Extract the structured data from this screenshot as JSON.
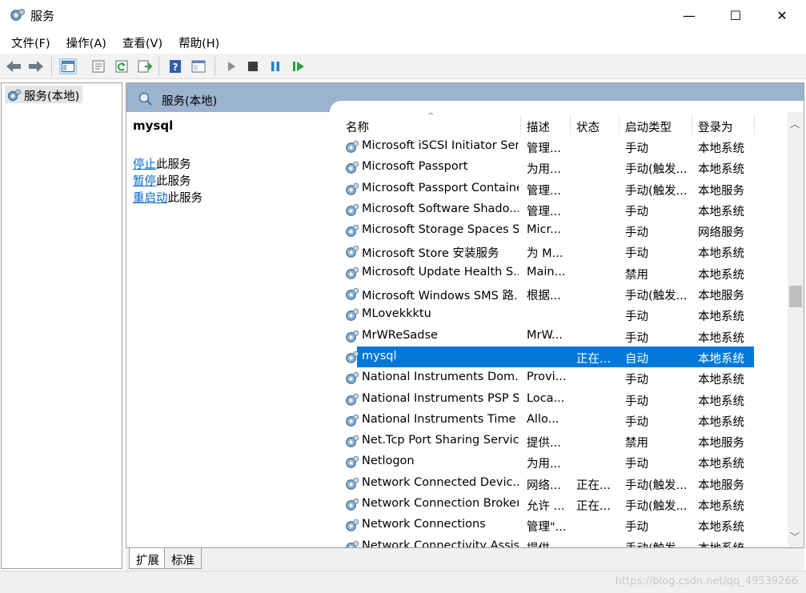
{
  "window": {
    "title": "服务",
    "minimize": "—",
    "maximize": "☐",
    "close": "✕"
  },
  "menu": [
    "文件(F)",
    "操作(A)",
    "查看(V)",
    "帮助(H)"
  ],
  "toolbar": {
    "icons": [
      "back-icon",
      "forward-icon",
      "show-hide-tree-icon",
      "properties-icon",
      "refresh-icon",
      "export-list-icon",
      "help-icon",
      "console-view-icon",
      "start-service-icon",
      "stop-service-icon",
      "pause-service-icon",
      "restart-service-icon"
    ]
  },
  "tree": {
    "root": "服务(本地)"
  },
  "panel": {
    "header": "服务(本地)",
    "selected_service": "mysql",
    "actions": [
      {
        "link": "停止",
        "suffix": "此服务"
      },
      {
        "link": "暂停",
        "suffix": "此服务"
      },
      {
        "link": "重启动",
        "suffix": "此服务"
      }
    ]
  },
  "table": {
    "columns": [
      "名称",
      "描述",
      "状态",
      "启动类型",
      "登录为"
    ],
    "rows": [
      {
        "name": "Microsoft iSCSI Initiator Ser...",
        "desc": "管理...",
        "state": "",
        "start": "手动",
        "logon": "本地系统"
      },
      {
        "name": "Microsoft Passport",
        "desc": "为用...",
        "state": "",
        "start": "手动(触发...",
        "logon": "本地系统"
      },
      {
        "name": "Microsoft Passport Container",
        "desc": "管理...",
        "state": "",
        "start": "手动(触发...",
        "logon": "本地服务"
      },
      {
        "name": "Microsoft Software Shado...",
        "desc": "管理...",
        "state": "",
        "start": "手动",
        "logon": "本地系统"
      },
      {
        "name": "Microsoft Storage Spaces S...",
        "desc": "Micr...",
        "state": "",
        "start": "手动",
        "logon": "网络服务"
      },
      {
        "name": "Microsoft Store 安装服务",
        "desc": "为 M...",
        "state": "",
        "start": "手动",
        "logon": "本地系统"
      },
      {
        "name": "Microsoft Update Health S...",
        "desc": "Main...",
        "state": "",
        "start": "禁用",
        "logon": "本地系统"
      },
      {
        "name": "Microsoft Windows SMS 路...",
        "desc": "根据...",
        "state": "",
        "start": "手动(触发...",
        "logon": "本地服务"
      },
      {
        "name": "MLovekkktu",
        "desc": "",
        "state": "",
        "start": "手动",
        "logon": "本地系统"
      },
      {
        "name": "MrWReSadse",
        "desc": "MrW...",
        "state": "",
        "start": "手动",
        "logon": "本地系统"
      },
      {
        "name": "mysql",
        "desc": "",
        "state": "正在...",
        "start": "自动",
        "logon": "本地系统",
        "selected": true
      },
      {
        "name": "National Instruments Dom...",
        "desc": "Provi...",
        "state": "",
        "start": "手动",
        "logon": "本地系统"
      },
      {
        "name": "National Instruments PSP S...",
        "desc": "Loca...",
        "state": "",
        "start": "手动",
        "logon": "本地系统"
      },
      {
        "name": "National Instruments Time ...",
        "desc": "Allo...",
        "state": "",
        "start": "手动",
        "logon": "本地系统"
      },
      {
        "name": "Net.Tcp Port Sharing Service",
        "desc": "提供...",
        "state": "",
        "start": "禁用",
        "logon": "本地服务"
      },
      {
        "name": "Netlogon",
        "desc": "为用...",
        "state": "",
        "start": "手动",
        "logon": "本地系统"
      },
      {
        "name": "Network Connected Devic...",
        "desc": "网络...",
        "state": "正在...",
        "start": "手动(触发...",
        "logon": "本地服务"
      },
      {
        "name": "Network Connection Broker",
        "desc": "允许 ...",
        "state": "正在...",
        "start": "手动(触发...",
        "logon": "本地系统"
      },
      {
        "name": "Network Connections",
        "desc": "管理\"...",
        "state": "",
        "start": "手动",
        "logon": "本地系统"
      },
      {
        "name": "Network Connectivity Assis...",
        "desc": "提供...",
        "state": "",
        "start": "手动(触发...",
        "logon": "本地系统"
      }
    ]
  },
  "tabs": [
    "扩展",
    "标准"
  ],
  "watermark": "https://blog.csdn.net/qq_49539266"
}
